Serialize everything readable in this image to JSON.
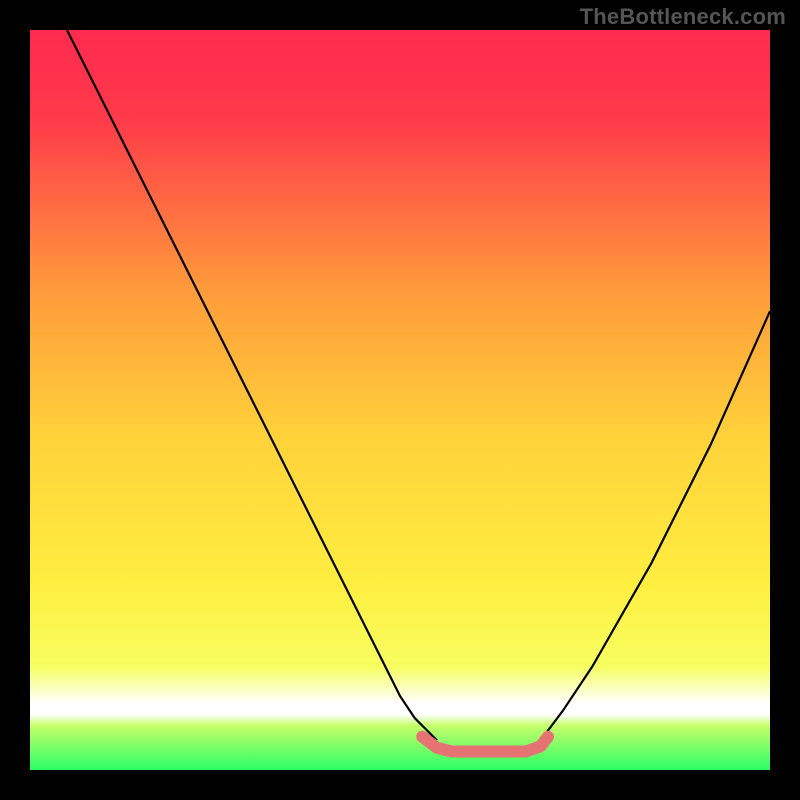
{
  "watermark": "TheBottleneck.com",
  "chart_data": {
    "type": "line",
    "title": "",
    "xlabel": "",
    "ylabel": "",
    "xlim": [
      0,
      100
    ],
    "ylim": [
      0,
      100
    ],
    "grid": false,
    "legend": false,
    "background": {
      "type": "vertical_gradient",
      "top_color": "#ff2a4f",
      "mid_color": "#ffe23a",
      "bottom_color": "#2bff66",
      "bottom_band_color": "#ffffff"
    },
    "series": [
      {
        "name": "left_branch",
        "color": "#000000",
        "stroke_width": 2,
        "x": [
          5,
          10,
          15,
          20,
          25,
          30,
          35,
          40,
          45,
          50,
          52,
          55
        ],
        "y": [
          100,
          90,
          80,
          70,
          60,
          50,
          40,
          30,
          20,
          10,
          7,
          4
        ]
      },
      {
        "name": "right_branch",
        "color": "#000000",
        "stroke_width": 2,
        "x": [
          69,
          72,
          76,
          80,
          84,
          88,
          92,
          96,
          100
        ],
        "y": [
          4,
          8,
          14,
          21,
          28,
          36,
          44,
          53,
          62
        ]
      },
      {
        "name": "valley_floor_marker",
        "color": "#e57373",
        "stroke_width": 8,
        "x": [
          53,
          55,
          57,
          59,
          61,
          63,
          65,
          67,
          69,
          70
        ],
        "y": [
          4.5,
          3.0,
          2.5,
          2.5,
          2.5,
          2.5,
          2.5,
          2.5,
          3.2,
          4.5
        ]
      }
    ],
    "interpretation": "V-shaped bottleneck curve; minimum (optimal match) occurs between x≈53 and x≈70 where y is near 0. Left branch descends steeply from top-left; right branch rises moderately toward upper-right. Pink highlighted segment marks the near-zero valley floor."
  }
}
